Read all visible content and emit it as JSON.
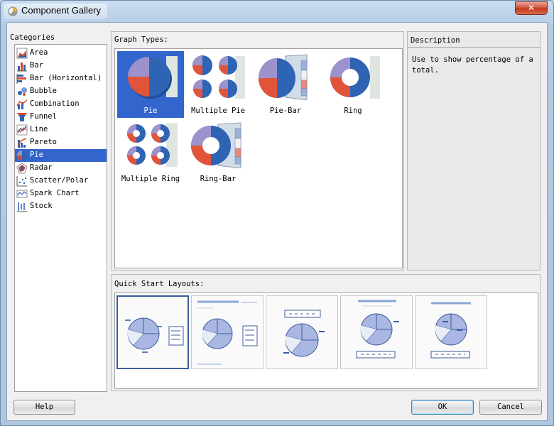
{
  "window": {
    "title": "Component Gallery",
    "close_glyph": "✕"
  },
  "categories": {
    "label": "Categories",
    "items": [
      {
        "label": "Area",
        "icon": "area-chart-icon"
      },
      {
        "label": "Bar",
        "icon": "bar-chart-icon"
      },
      {
        "label": "Bar (Horizontal)",
        "icon": "horizontal-bar-chart-icon"
      },
      {
        "label": "Bubble",
        "icon": "bubble-chart-icon"
      },
      {
        "label": "Combination",
        "icon": "combination-chart-icon"
      },
      {
        "label": "Funnel",
        "icon": "funnel-chart-icon"
      },
      {
        "label": "Line",
        "icon": "line-chart-icon"
      },
      {
        "label": "Pareto",
        "icon": "pareto-chart-icon"
      },
      {
        "label": "Pie",
        "icon": "pie-chart-icon",
        "selected": true
      },
      {
        "label": "Radar",
        "icon": "radar-chart-icon"
      },
      {
        "label": "Scatter/Polar",
        "icon": "scatter-chart-icon"
      },
      {
        "label": "Spark Chart",
        "icon": "spark-chart-icon"
      },
      {
        "label": "Stock",
        "icon": "stock-chart-icon"
      }
    ]
  },
  "graph_types": {
    "label": "Graph Types:",
    "items": [
      {
        "label": "Pie",
        "icon": "pie-thumbnail",
        "selected": true
      },
      {
        "label": "Multiple Pie",
        "icon": "multiple-pie-thumbnail"
      },
      {
        "label": "Pie-Bar",
        "icon": "pie-bar-thumbnail"
      },
      {
        "label": "Ring",
        "icon": "ring-thumbnail"
      },
      {
        "label": "Multiple Ring",
        "icon": "multiple-ring-thumbnail"
      },
      {
        "label": "Ring-Bar",
        "icon": "ring-bar-thumbnail"
      }
    ]
  },
  "description": {
    "label": "Description",
    "text": "Use to show percentage of a total."
  },
  "quick_start": {
    "label": "Quick Start Layouts:",
    "layouts": [
      "layout-legend-right",
      "layout-title-legend-right",
      "layout-legend-top",
      "layout-title-legend-bottom",
      "layout-title-legend-bottom-compact"
    ]
  },
  "buttons": {
    "help": "Help",
    "ok": "OK",
    "cancel": "Cancel"
  },
  "colors": {
    "selection": "#3366cc",
    "pie_blue": "#2f63b4",
    "pie_red": "#e0553a",
    "pie_purple": "#9c92cc"
  }
}
